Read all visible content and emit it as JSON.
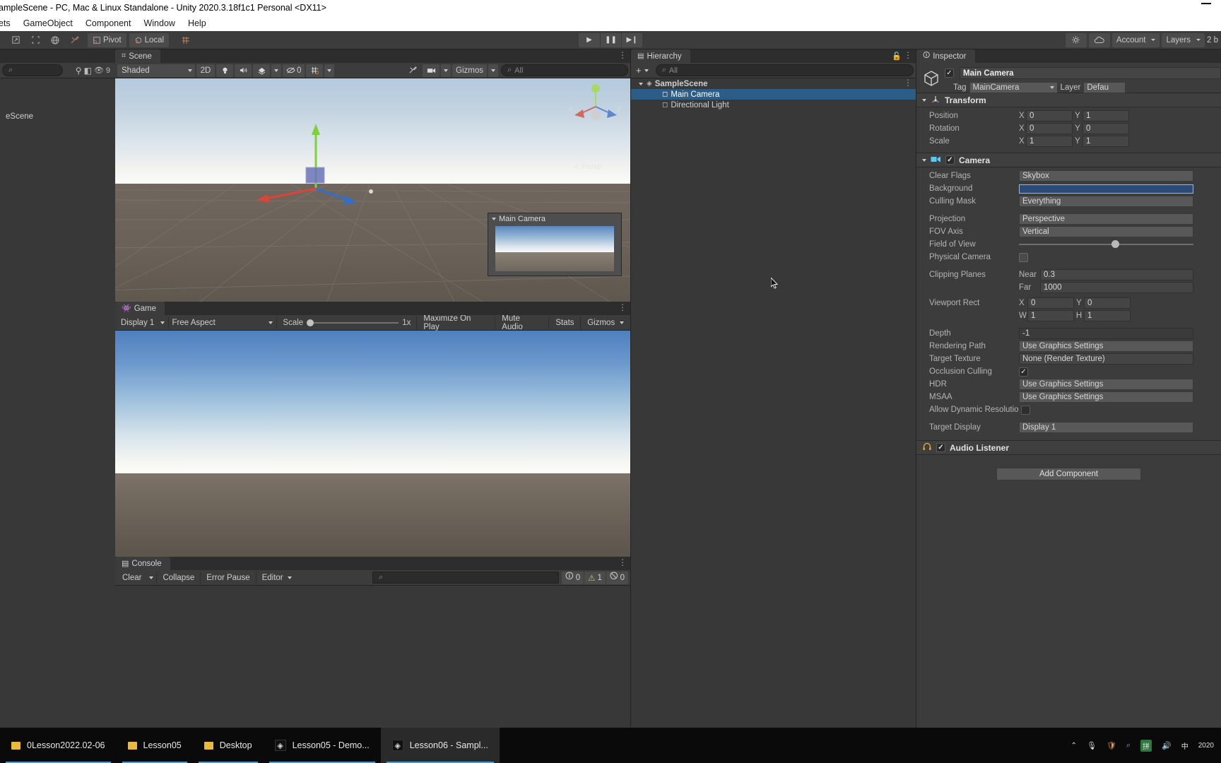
{
  "window": {
    "title": "ampleScene - PC, Mac & Linux Standalone - Unity 2020.3.18f1c1 Personal <DX11>",
    "minimize": "minimize-icon"
  },
  "menu": {
    "items": [
      "ets",
      "GameObject",
      "Component",
      "Window",
      "Help"
    ]
  },
  "toolbar": {
    "tools": [
      "hand-tool",
      "rect-tool",
      "rotate-tool",
      "custom-tool"
    ],
    "pivot": "Pivot",
    "local": "Local",
    "grid": "grid-snap-icon",
    "play": "play-icon",
    "pause": "pause-icon",
    "step": "step-icon",
    "cloud": "cloud-icon",
    "services": "services-icon",
    "account": "Account",
    "layers": "Layers",
    "layout": "2 b"
  },
  "scene": {
    "tab": "Scene",
    "shading": "Shaded",
    "mode_2d": "2D",
    "lighting": "light-icon",
    "audio": "audio-icon",
    "fx": "fx-icon",
    "hidden_count": "0",
    "grid": "grid-icon",
    "tools_icon": "scene-tools-icon",
    "camera_icon": "scene-camera-icon",
    "gizmos": "Gizmos",
    "search_placeholder": "All",
    "persp_label": "Persp",
    "axis_x": "x",
    "axis_y": "y",
    "axis_z": "z",
    "preview_title": "Main Camera"
  },
  "game": {
    "tab": "Game",
    "display": "Display 1",
    "aspect": "Free Aspect",
    "scale_label": "Scale",
    "scale_value": "1x",
    "maximize": "Maximize On Play",
    "mute": "Mute Audio",
    "stats": "Stats",
    "gizmos": "Gizmos"
  },
  "console": {
    "tab": "Console",
    "clear": "Clear",
    "collapse": "Collapse",
    "error_pause": "Error Pause",
    "editor": "Editor",
    "search_placeholder": "",
    "log_count": "0",
    "warn_count": "1",
    "error_count": "0"
  },
  "hierarchy": {
    "tab": "Hierarchy",
    "add_label": "+",
    "search_placeholder": "All",
    "items": [
      {
        "label": "SampleScene",
        "depth": 0,
        "selected": false,
        "icon": "scene-icon"
      },
      {
        "label": "Main Camera",
        "depth": 1,
        "selected": true,
        "icon": "gameobject-icon"
      },
      {
        "label": "Directional Light",
        "depth": 1,
        "selected": false,
        "icon": "gameobject-icon"
      }
    ]
  },
  "inspector": {
    "tab": "Inspector",
    "object_name": "Main Camera",
    "object_enabled": true,
    "tag_label": "Tag",
    "tag_value": "MainCamera",
    "layer_label": "Layer",
    "layer_value": "Defau",
    "transform": {
      "title": "Transform",
      "rows": [
        {
          "label": "Position",
          "x": "0",
          "y": "1"
        },
        {
          "label": "Rotation",
          "x": "0",
          "y": "0"
        },
        {
          "label": "Scale",
          "x": "1",
          "y": "1"
        }
      ]
    },
    "camera": {
      "title": "Camera",
      "enabled": true,
      "clear_flags_label": "Clear Flags",
      "clear_flags_value": "Skybox",
      "background_label": "Background",
      "background_color": "#2b4a78",
      "culling_label": "Culling Mask",
      "culling_value": "Everything",
      "projection_label": "Projection",
      "projection_value": "Perspective",
      "fov_axis_label": "FOV Axis",
      "fov_axis_value": "Vertical",
      "fov_label": "Field of View",
      "fov_slider_pct": 53,
      "physical_label": "Physical Camera",
      "physical_checked": false,
      "clipping_label": "Clipping Planes",
      "near_label": "Near",
      "near_value": "0.3",
      "far_label": "Far",
      "far_value": "1000",
      "viewport_label": "Viewport Rect",
      "vp_x_label": "X",
      "vp_x": "0",
      "vp_y_label": "Y",
      "vp_y": "0",
      "vp_w_label": "W",
      "vp_w": "1",
      "vp_h_label": "H",
      "vp_h": "1",
      "depth_label": "Depth",
      "depth_value": "-1",
      "rendering_label": "Rendering Path",
      "rendering_value": "Use Graphics Settings",
      "target_texture_label": "Target Texture",
      "target_texture_value": "None (Render Texture)",
      "occlusion_label": "Occlusion Culling",
      "occlusion_checked": true,
      "hdr_label": "HDR",
      "hdr_value": "Use Graphics Settings",
      "msaa_label": "MSAA",
      "msaa_value": "Use Graphics Settings",
      "dynamic_label": "Allow Dynamic Resolutio",
      "dynamic_checked": false,
      "target_display_label": "Target Display",
      "target_display_value": "Display 1"
    },
    "audio_listener": {
      "title": "Audio Listener",
      "enabled": true
    },
    "add_component": "Add Component"
  },
  "project_panel": {
    "search_placeholder": "",
    "count_badge": "9",
    "scene_label": "eScene"
  },
  "taskbar": {
    "items": [
      {
        "label": "0Lesson2022.02-06",
        "icon": "folder-icon",
        "active": false
      },
      {
        "label": "Lesson05",
        "icon": "folder-icon",
        "active": false
      },
      {
        "label": "Desktop",
        "icon": "folder-icon",
        "active": false
      },
      {
        "label": "Lesson05 - Demo...",
        "icon": "unity-icon",
        "active": false
      },
      {
        "label": "Lesson06 - Sampl...",
        "icon": "unity-icon",
        "active": true
      }
    ],
    "tray": [
      "chevron-up-icon",
      "mic-icon",
      "shield-icon",
      "search-icon",
      "ime-icon",
      "speaker-icon",
      "keyboard-icon"
    ],
    "clock": "2020"
  }
}
